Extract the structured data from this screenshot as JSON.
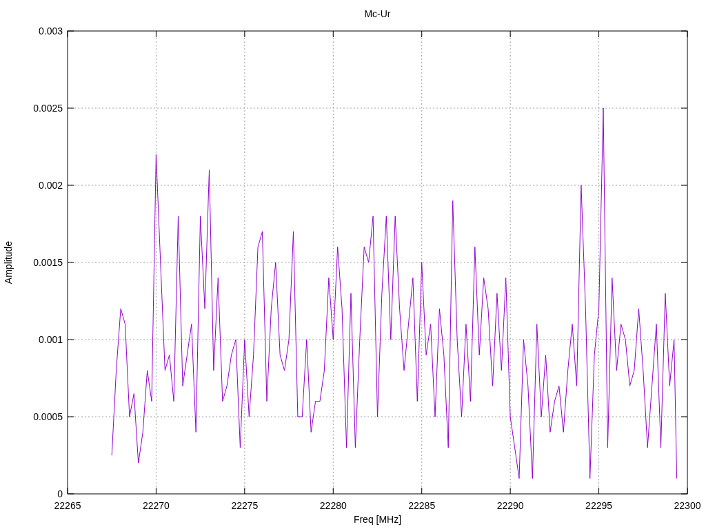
{
  "chart_data": {
    "type": "line",
    "title": "Mc-Ur",
    "grid": true,
    "xlabel": "Freq [MHz]",
    "ylabel": "Amplitude",
    "xlim": [
      22265,
      22300
    ],
    "ylim": [
      0,
      0.003
    ],
    "xticks": [
      22265,
      22270,
      22275,
      22280,
      22285,
      22290,
      22295,
      22300
    ],
    "yticks": [
      {
        "value": 0,
        "label": "0"
      },
      {
        "value": 0.0005,
        "label": "0.0005"
      },
      {
        "value": 0.001,
        "label": "0.001"
      },
      {
        "value": 0.0015,
        "label": "0.0015"
      },
      {
        "value": 0.002,
        "label": "0.002"
      },
      {
        "value": 0.0025,
        "label": "0.0025"
      },
      {
        "value": 0.003,
        "label": "0.003"
      }
    ],
    "x": [
      22267.5,
      22267.75,
      22268,
      22268.25,
      22268.5,
      22268.75,
      22269,
      22269.25,
      22269.5,
      22269.75,
      22270,
      22270.25,
      22270.5,
      22270.75,
      22271,
      22271.25,
      22271.5,
      22271.75,
      22272,
      22272.25,
      22272.5,
      22272.75,
      22273,
      22273.25,
      22273.5,
      22273.75,
      22274,
      22274.25,
      22274.5,
      22274.75,
      22275,
      22275.25,
      22275.5,
      22275.75,
      22276,
      22276.25,
      22276.5,
      22276.75,
      22277,
      22277.25,
      22277.5,
      22277.75,
      22278,
      22278.25,
      22278.5,
      22278.75,
      22279,
      22279.25,
      22279.5,
      22279.75,
      22280,
      22280.25,
      22280.5,
      22280.75,
      22281,
      22281.25,
      22281.5,
      22281.75,
      22282,
      22282.25,
      22282.5,
      22282.75,
      22283,
      22283.25,
      22283.5,
      22283.75,
      22284,
      22284.25,
      22284.5,
      22284.75,
      22285,
      22285.25,
      22285.5,
      22285.75,
      22286,
      22286.25,
      22286.5,
      22286.75,
      22287,
      22287.25,
      22287.5,
      22287.75,
      22288,
      22288.25,
      22288.5,
      22288.75,
      22289,
      22289.25,
      22289.5,
      22289.75,
      22290,
      22290.25,
      22290.5,
      22290.75,
      22291,
      22291.25,
      22291.5,
      22291.75,
      22292,
      22292.25,
      22292.5,
      22292.75,
      22293,
      22293.25,
      22293.5,
      22293.75,
      22294,
      22294.25,
      22294.5,
      22294.75,
      22295,
      22295.25,
      22295.5,
      22295.75,
      22296,
      22296.25,
      22296.5,
      22296.75,
      22297,
      22297.25,
      22297.5,
      22297.75,
      22298,
      22298.25,
      22298.5,
      22298.75,
      22299,
      22299.25,
      22299.4
    ],
    "series": [
      {
        "color": "#9400d3",
        "values": [
          0.00025,
          0.0008,
          0.0012,
          0.0011,
          0.0005,
          0.00065,
          0.0002,
          0.0004,
          0.0008,
          0.0006,
          0.0022,
          0.0015,
          0.0008,
          0.0009,
          0.0006,
          0.0018,
          0.0007,
          0.0009,
          0.0011,
          0.0004,
          0.0018,
          0.0012,
          0.0021,
          0.0008,
          0.0014,
          0.0006,
          0.0007,
          0.0009,
          0.001,
          0.0003,
          0.001,
          0.0005,
          0.0009,
          0.0016,
          0.0017,
          0.0006,
          0.0012,
          0.0015,
          0.0009,
          0.0008,
          0.001,
          0.0017,
          0.0005,
          0.0005,
          0.001,
          0.0004,
          0.0006,
          0.0006,
          0.0008,
          0.0014,
          0.001,
          0.0016,
          0.0012,
          0.0003,
          0.0013,
          0.0003,
          0.001,
          0.0016,
          0.0015,
          0.0018,
          0.0005,
          0.0013,
          0.0018,
          0.001,
          0.0018,
          0.0012,
          0.0008,
          0.0011,
          0.0014,
          0.0006,
          0.0015,
          0.0009,
          0.0011,
          0.0005,
          0.0012,
          0.0009,
          0.0003,
          0.0019,
          0.001,
          0.0005,
          0.0011,
          0.0006,
          0.0016,
          0.0009,
          0.0014,
          0.0012,
          0.0007,
          0.0013,
          0.0008,
          0.0014,
          0.0005,
          0.0003,
          0.0001,
          0.001,
          0.0007,
          0.0001,
          0.0011,
          0.0005,
          0.0009,
          0.0004,
          0.0006,
          0.0007,
          0.0004,
          0.0008,
          0.0011,
          0.0007,
          0.002,
          0.0012,
          0.0001,
          0.0009,
          0.0012,
          0.0025,
          0.0003,
          0.0014,
          0.0008,
          0.0011,
          0.001,
          0.0007,
          0.0008,
          0.0012,
          0.0008,
          0.0003,
          0.0007,
          0.0011,
          0.0003,
          0.0013,
          0.0007,
          0.001,
          0.0001
        ]
      }
    ]
  }
}
